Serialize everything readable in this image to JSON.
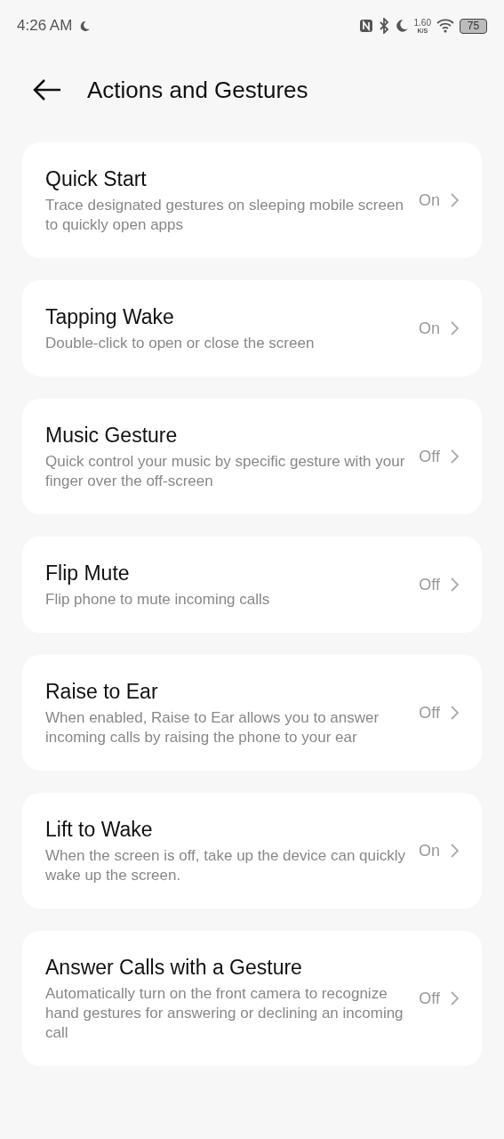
{
  "status_bar": {
    "time": "4:26 AM",
    "speed_value": "1.60",
    "speed_unit": "K/S",
    "battery": "75"
  },
  "header": {
    "title": "Actions and Gestures"
  },
  "items": [
    {
      "title": "Quick Start",
      "description": "Trace designated gestures on sleeping mobile screen to quickly open apps",
      "value": "On"
    },
    {
      "title": "Tapping Wake",
      "description": "Double-click to open or close the screen",
      "value": "On"
    },
    {
      "title": "Music Gesture",
      "description": "Quick control your music by specific gesture with your finger over the off-screen",
      "value": "Off"
    },
    {
      "title": "Flip Mute",
      "description": "Flip phone to mute incoming calls",
      "value": "Off"
    },
    {
      "title": "Raise to Ear",
      "description": "When enabled, Raise to Ear allows you to answer incoming calls by raising the phone to your ear",
      "value": "Off"
    },
    {
      "title": "Lift to Wake",
      "description": "When the screen is off, take up the device can quickly wake up the screen.",
      "value": "On"
    },
    {
      "title": "Answer Calls with a Gesture",
      "description": "Automatically turn on the front camera to recognize hand gestures for answering or declining an incoming call",
      "value": "Off"
    }
  ]
}
